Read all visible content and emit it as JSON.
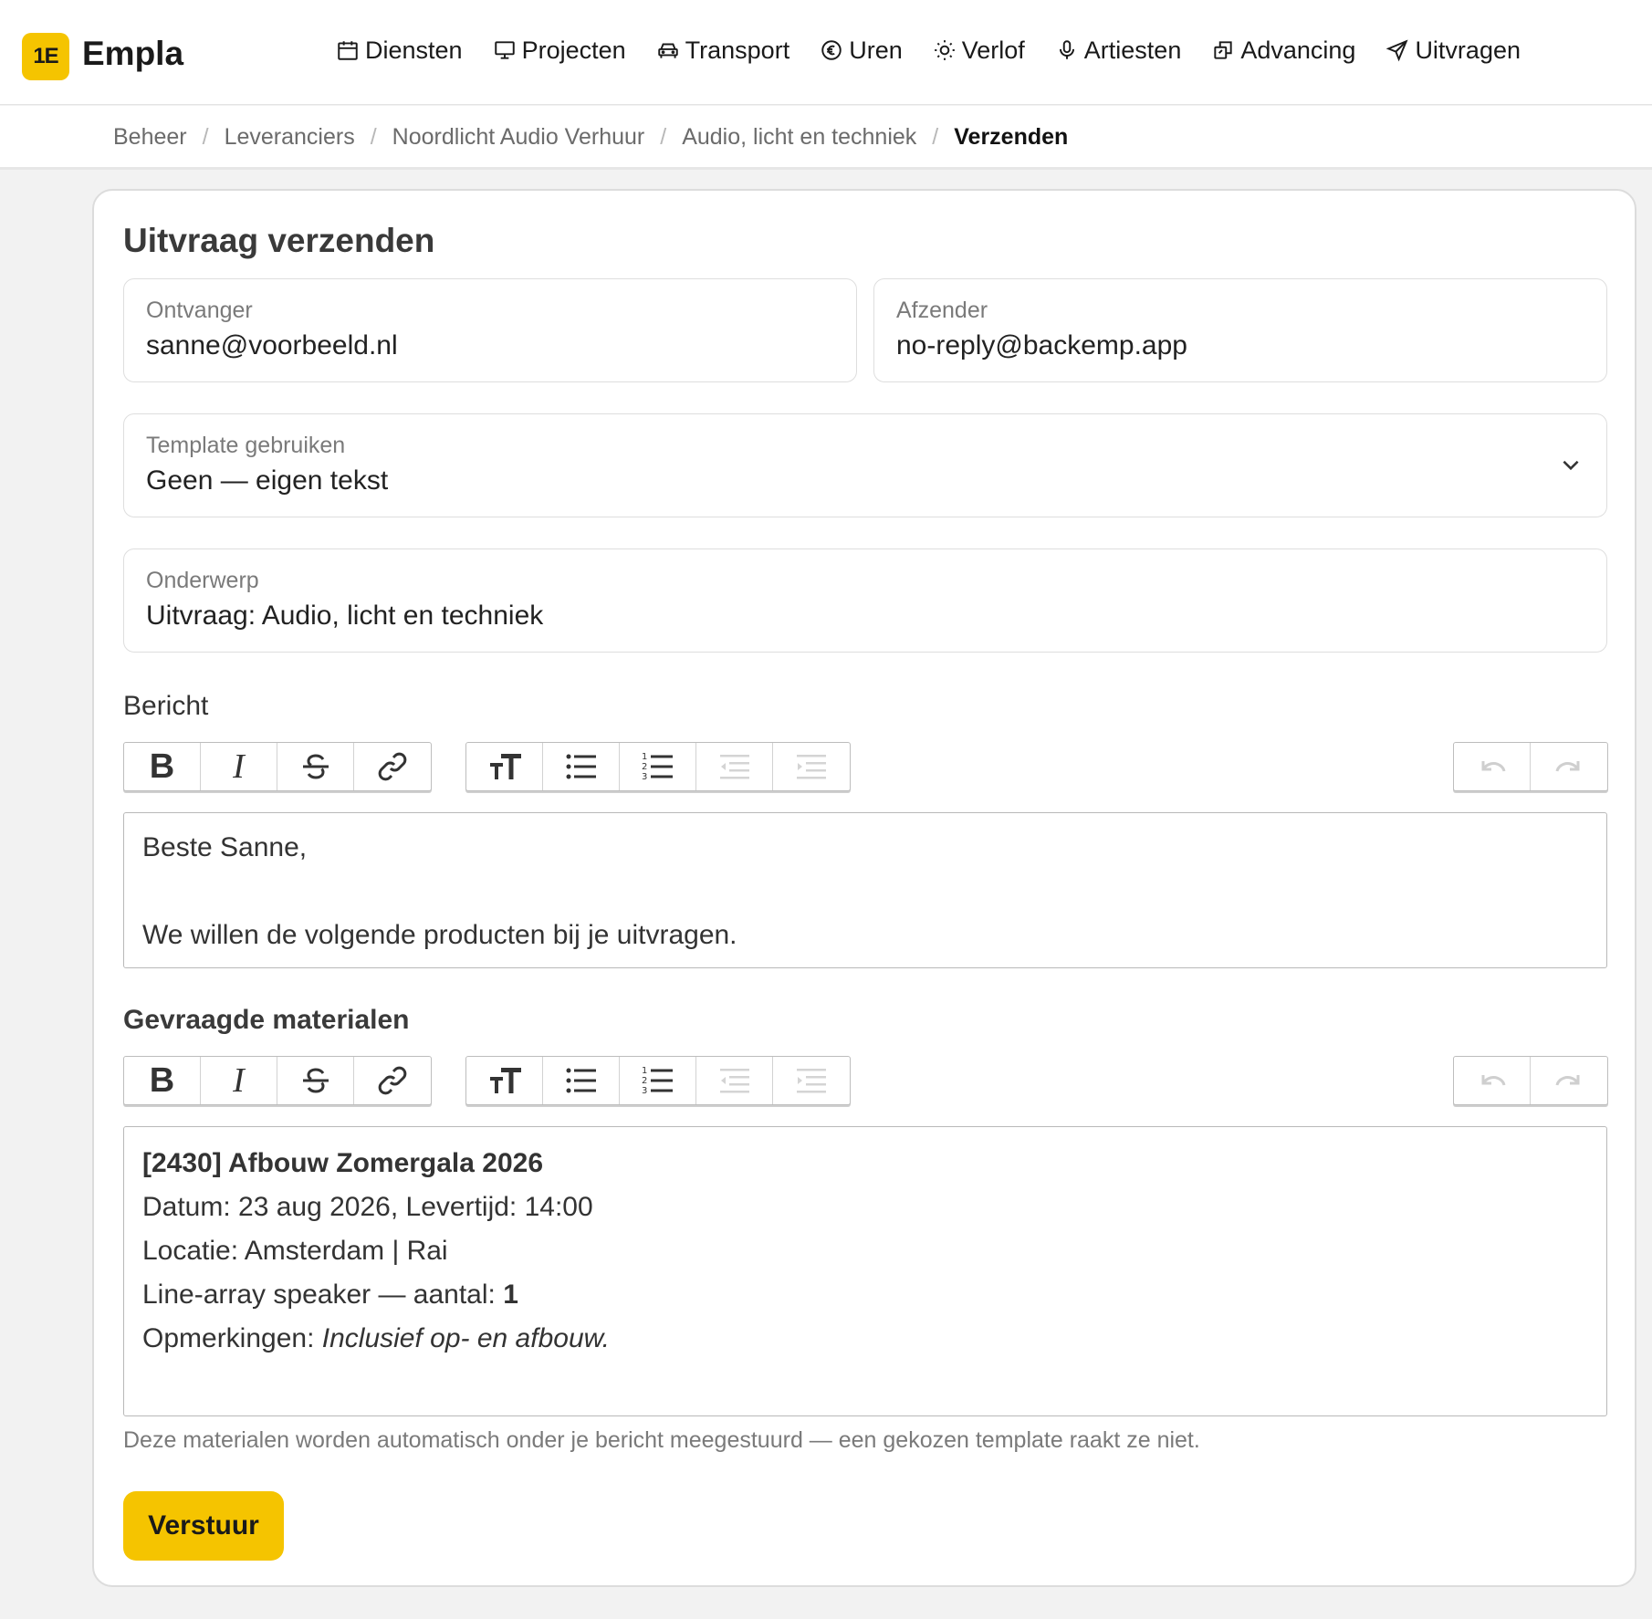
{
  "app": {
    "logo_mark": "1E",
    "name": "Empla"
  },
  "nav": [
    {
      "label": "Diensten",
      "icon": "calendar-icon"
    },
    {
      "label": "Projecten",
      "icon": "monitor-icon"
    },
    {
      "label": "Transport",
      "icon": "car-icon"
    },
    {
      "label": "Uren",
      "icon": "euro-circle-icon"
    },
    {
      "label": "Verlof",
      "icon": "sun-icon"
    },
    {
      "label": "Artiesten",
      "icon": "microphone-icon"
    },
    {
      "label": "Advancing",
      "icon": "copy-icon"
    },
    {
      "label": "Uitvragen",
      "icon": "send-icon"
    }
  ],
  "breadcrumb": {
    "items": [
      "Beheer",
      "Leveranciers",
      "Noordlicht Audio Verhuur",
      "Audio, licht en techniek"
    ],
    "current": "Verzenden",
    "separator": "/"
  },
  "form": {
    "title": "Uitvraag verzenden",
    "recipient": {
      "label": "Ontvanger",
      "value": "sanne@voorbeeld.nl"
    },
    "sender": {
      "label": "Afzender",
      "value": "no-reply@backemp.app"
    },
    "template": {
      "label": "Template gebruiken",
      "value": "Geen — eigen tekst"
    },
    "subject": {
      "label": "Onderwerp",
      "value": "Uitvraag: Audio, licht en techniek"
    },
    "message": {
      "label": "Bericht",
      "line1": "Beste Sanne,",
      "line2": "We willen de volgende producten bij je uitvragen."
    },
    "materials": {
      "label": "Gevraagde materialen",
      "heading": "[2430] Afbouw Zomergala 2026",
      "date_line": "Datum: 23 aug 2026, Levertijd: 14:00",
      "location_line": "Locatie: Amsterdam | Rai",
      "item_prefix": "Line-array speaker — aantal: ",
      "item_qty": "1",
      "remarks_prefix": "Opmerkingen: ",
      "remarks_value": "Inclusief op- en afbouw."
    },
    "helper": "Deze materialen worden automatisch onder je bericht meegestuurd — een gekozen template raakt ze niet.",
    "submit": "Verstuur"
  },
  "toolbar": {
    "bold": "B",
    "italic": "I"
  },
  "colors": {
    "accent": "#f5c400"
  }
}
